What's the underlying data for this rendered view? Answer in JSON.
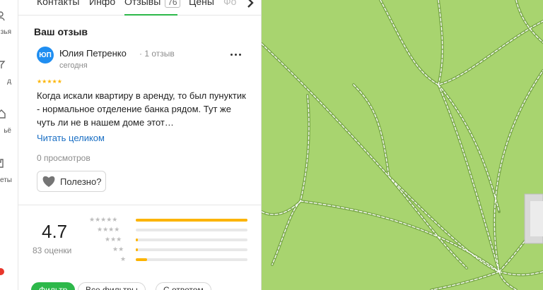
{
  "rail": {
    "items": [
      {
        "label": "зья",
        "icon": "people-icon"
      },
      {
        "label": "д",
        "icon": "filter-icon"
      },
      {
        "label": "ьё",
        "icon": "house-icon"
      },
      {
        "label": "еты",
        "icon": "hand-icon"
      }
    ]
  },
  "tabs": {
    "items": [
      {
        "label": "Контакты"
      },
      {
        "label": "Инфо"
      },
      {
        "label": "Отзывы",
        "count": "76"
      },
      {
        "label": "Цены"
      },
      {
        "label": "Фо"
      }
    ],
    "active": "Отзывы"
  },
  "review_section": {
    "title": "Ваш отзыв",
    "avatar_initials": "ЮП",
    "author": "Юлия Петренко",
    "author_reviews": "· 1 отзыв",
    "date": "сегодня",
    "rating": 5,
    "text": "Когда искали квартиру в аренду, то был пунуктик - нормальное отделение банка рядом. Тут же чуть ли не в нашем доме этот…",
    "read_more": "Читать целиком",
    "views": "0 просмотров",
    "useful_label": "Полезно?"
  },
  "summary": {
    "rating": "4.7",
    "count": "83 оценки",
    "distribution": [
      {
        "stars": 5,
        "fraction": 1.0
      },
      {
        "stars": 4,
        "fraction": 0.0
      },
      {
        "stars": 3,
        "fraction": 0.02
      },
      {
        "stars": 2,
        "fraction": 0.02
      },
      {
        "stars": 1,
        "fraction": 0.1
      }
    ]
  },
  "filters": [
    {
      "label": "Фильтр",
      "active": true
    },
    {
      "label": "Все фильтры",
      "active": false
    },
    {
      "label": "С ответом",
      "active": false
    }
  ],
  "colors": {
    "accent_green": "#2db84a",
    "star_yellow": "#fcb400",
    "link_blue": "#1a6fc4",
    "map_green": "#a8d46f"
  }
}
